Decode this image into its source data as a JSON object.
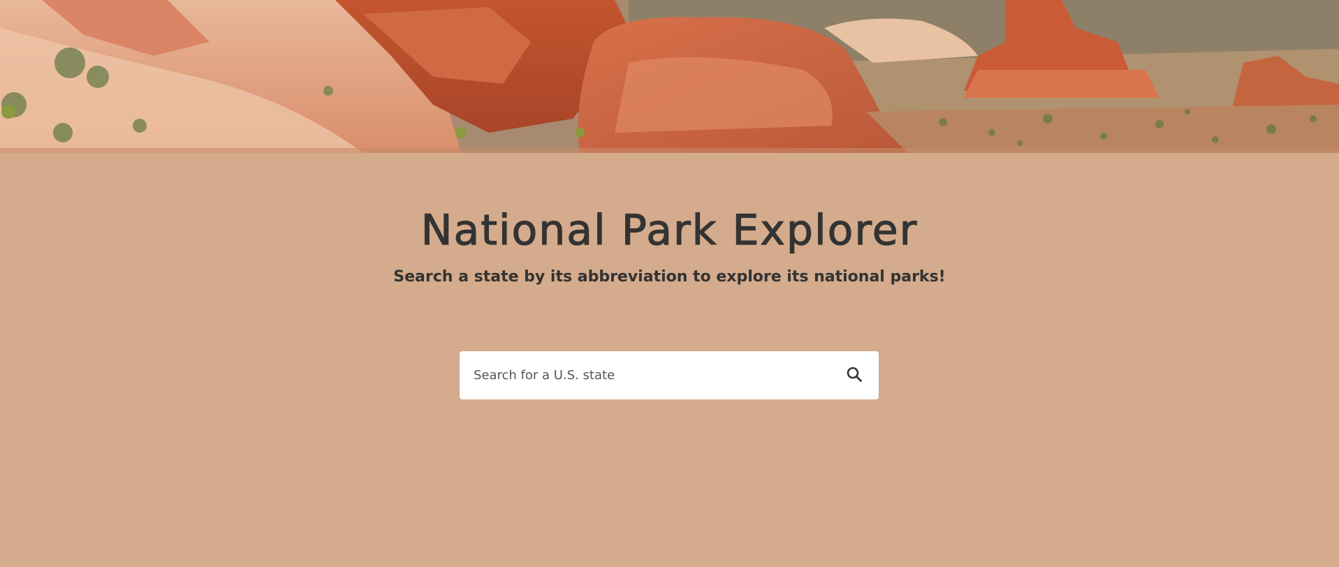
{
  "hero": {
    "image_alt": "Red rock desert landscape"
  },
  "header": {
    "title": "National Park Explorer",
    "subtitle": "Search a state by its abbreviation to explore its national parks!"
  },
  "search": {
    "placeholder": "Search for a U.S. state",
    "value": "",
    "icon": "search-icon"
  },
  "colors": {
    "background": "#d4ab8c",
    "text": "#333333",
    "search_bg": "#ffffff"
  }
}
